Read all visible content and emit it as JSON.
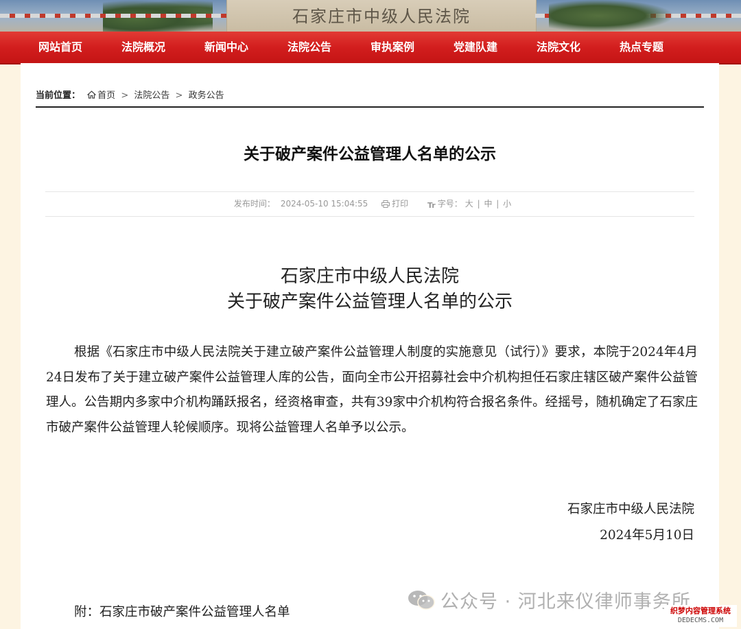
{
  "banner": {
    "stone_title": "石家庄市中级人民法院"
  },
  "nav": {
    "items": [
      "网站首页",
      "法院概况",
      "新闻中心",
      "法院公告",
      "审执案例",
      "党建队建",
      "法院文化",
      "热点专题"
    ]
  },
  "breadcrumb": {
    "label": "当前位置：",
    "items": [
      "首页",
      "法院公告",
      "政务公告"
    ],
    "separator": ">"
  },
  "article": {
    "title": "关于破产案件公益管理人名单的公示",
    "publish_label": "发布时间：",
    "publish_time": "2024-05-10 15:04:55",
    "print_label": "打印",
    "fontsize_label": "字号：",
    "fontsize_large": "大",
    "fontsize_medium": "中",
    "fontsize_small": "小",
    "fontsize_sep": "|",
    "heading_line1": "石家庄市中级人民法院",
    "heading_line2": "关于破产案件公益管理人名单的公示",
    "body": "根据《石家庄市中级人民法院关于建立破产案件公益管理人制度的实施意见（试行）》要求，本院于2024年4月24日发布了关于建立破产案件公益管理人库的公告，面向全市公开招募社会中介机构担任石家庄辖区破产案件公益管理人。公告期内多家中介机构踊跃报名，经资格审查，共有39家中介机构符合报名条件。经摇号，随机确定了石家庄市破产案件公益管理人轮候顺序。现将公益管理人名单予以公示。",
    "signature_org": "石家庄市中级人民法院",
    "signature_date": "2024年5月10日",
    "attachment": "附：石家庄市破产案件公益管理人名单"
  },
  "watermark": {
    "text": "公众号 · 河北来仪律师事务所"
  },
  "corner_badge": {
    "line1": "织梦内容管理系统",
    "line2": "DEDECMS.COM"
  },
  "colors": {
    "nav_red": "#d21e1e",
    "page_bg": "#fdf4e2"
  }
}
